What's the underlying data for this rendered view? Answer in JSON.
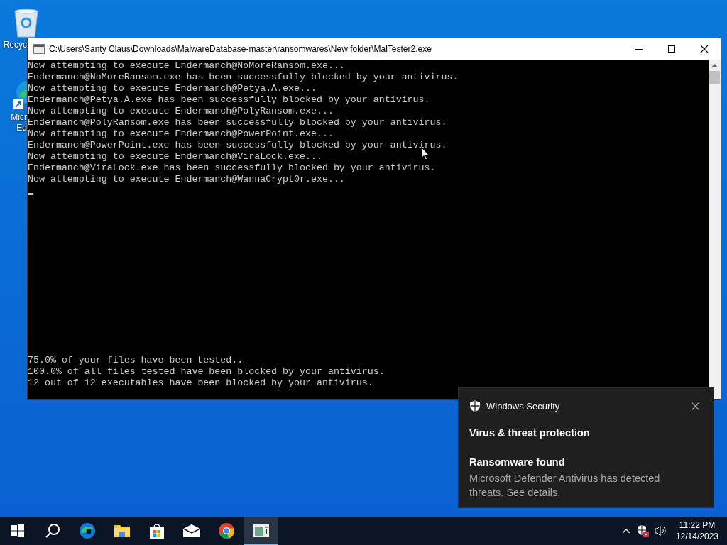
{
  "desktop_icons": [
    {
      "kind": "recycle-bin",
      "label_lines": [
        "Recyc"
      ]
    },
    {
      "kind": "edge",
      "label_lines": [
        "Micr",
        "Ed"
      ]
    }
  ],
  "console": {
    "title": "C:\\Users\\Santy Claus\\Downloads\\MalwareDatabase-master\\ransomwares\\New folder\\MalTester2.exe",
    "lines": [
      "Now attempting to execute Endermanch@NoMoreRansom.exe...",
      "Endermanch@NoMoreRansom.exe has been successfully blocked by your antivirus.",
      "Now attempting to execute Endermanch@Petya.A.exe...",
      "Endermanch@Petya.A.exe has been successfully blocked by your antivirus.",
      "Now attempting to execute Endermanch@PolyRansom.exe...",
      "Endermanch@PolyRansom.exe has been successfully blocked by your antivirus.",
      "Now attempting to execute Endermanch@PowerPoint.exe...",
      "Endermanch@PowerPoint.exe has been successfully blocked by your antivirus.",
      "Now attempting to execute Endermanch@ViraLock.exe...",
      "Endermanch@ViraLock.exe has been successfully blocked by your antivirus.",
      "Now attempting to execute Endermanch@WannaCrypt0r.exe..."
    ],
    "summary": [
      "75.0% of your files have been tested..",
      "100.0% of all files tested have been blocked by your antivirus.",
      "12 out of 12 executables have been blocked by your antivirus."
    ]
  },
  "notification": {
    "app": "Windows Security",
    "title": "Virus & threat protection",
    "heading": "Ransomware found",
    "body": "Microsoft Defender Antivirus has detected threats.  See details."
  },
  "taskbar": {
    "items": [
      {
        "kind": "start",
        "selected": false
      },
      {
        "kind": "search",
        "selected": false
      },
      {
        "kind": "edge",
        "selected": false
      },
      {
        "kind": "explorer",
        "selected": false
      },
      {
        "kind": "store",
        "selected": false
      },
      {
        "kind": "mail",
        "selected": false
      },
      {
        "kind": "chrome",
        "selected": false
      },
      {
        "kind": "console",
        "selected": true
      }
    ],
    "time": "11:22 PM",
    "date": "12/14/2023"
  }
}
